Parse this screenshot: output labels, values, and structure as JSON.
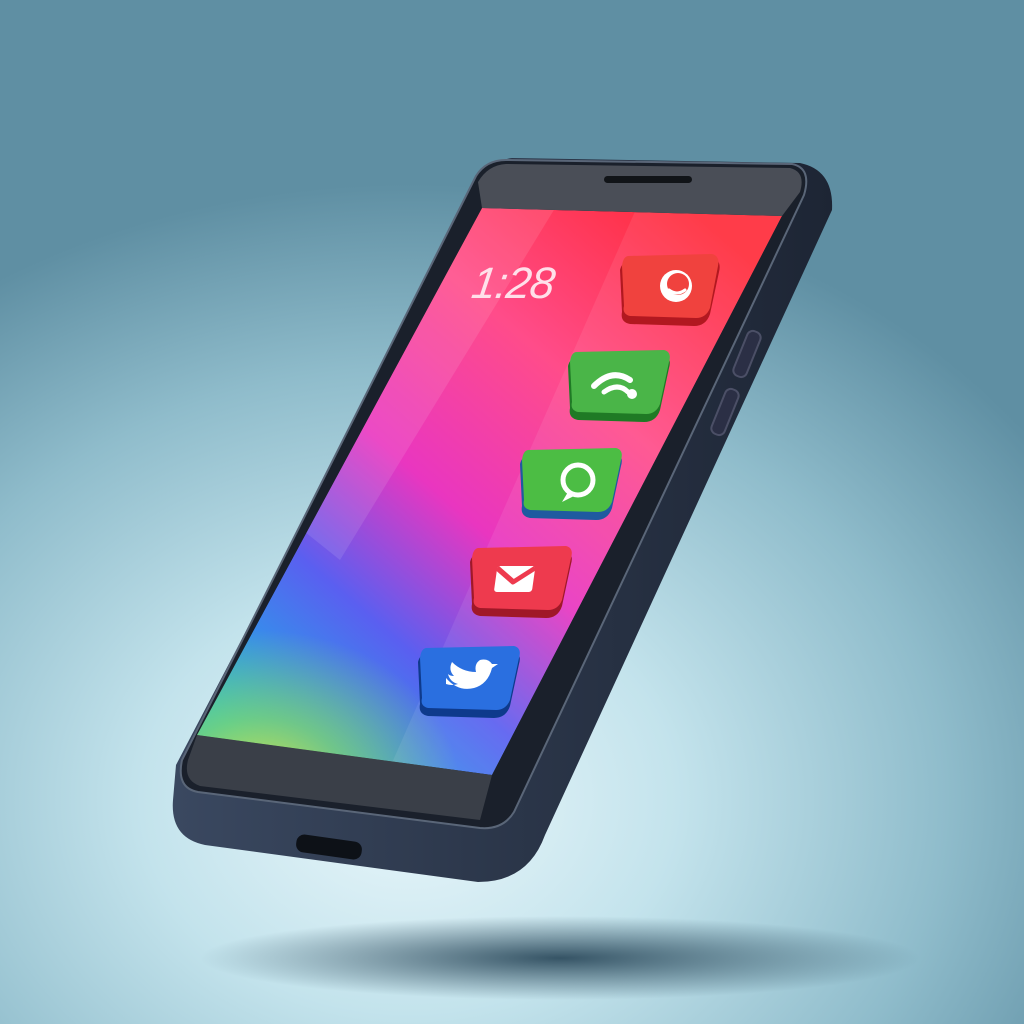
{
  "status_bar": {
    "time": "1:28"
  },
  "home_screen": {
    "apps": [
      {
        "name": "chat",
        "icon": "smiley-chat-icon",
        "color": "#e8323c"
      },
      {
        "name": "phone",
        "icon": "phone-handset-icon",
        "color": "#3fae3c"
      },
      {
        "name": "messaging",
        "icon": "chat-bubble-icon",
        "color": "#48b840"
      },
      {
        "name": "mail",
        "icon": "envelope-icon",
        "color": "#e02c40"
      },
      {
        "name": "twitter",
        "icon": "bird-icon",
        "color": "#1f62d6"
      }
    ]
  },
  "colors": {
    "background": "#8fbccb",
    "phone_body": "#2a3446",
    "screen_top": "#ff3a45",
    "screen_bottom": "#1ea6e0"
  }
}
